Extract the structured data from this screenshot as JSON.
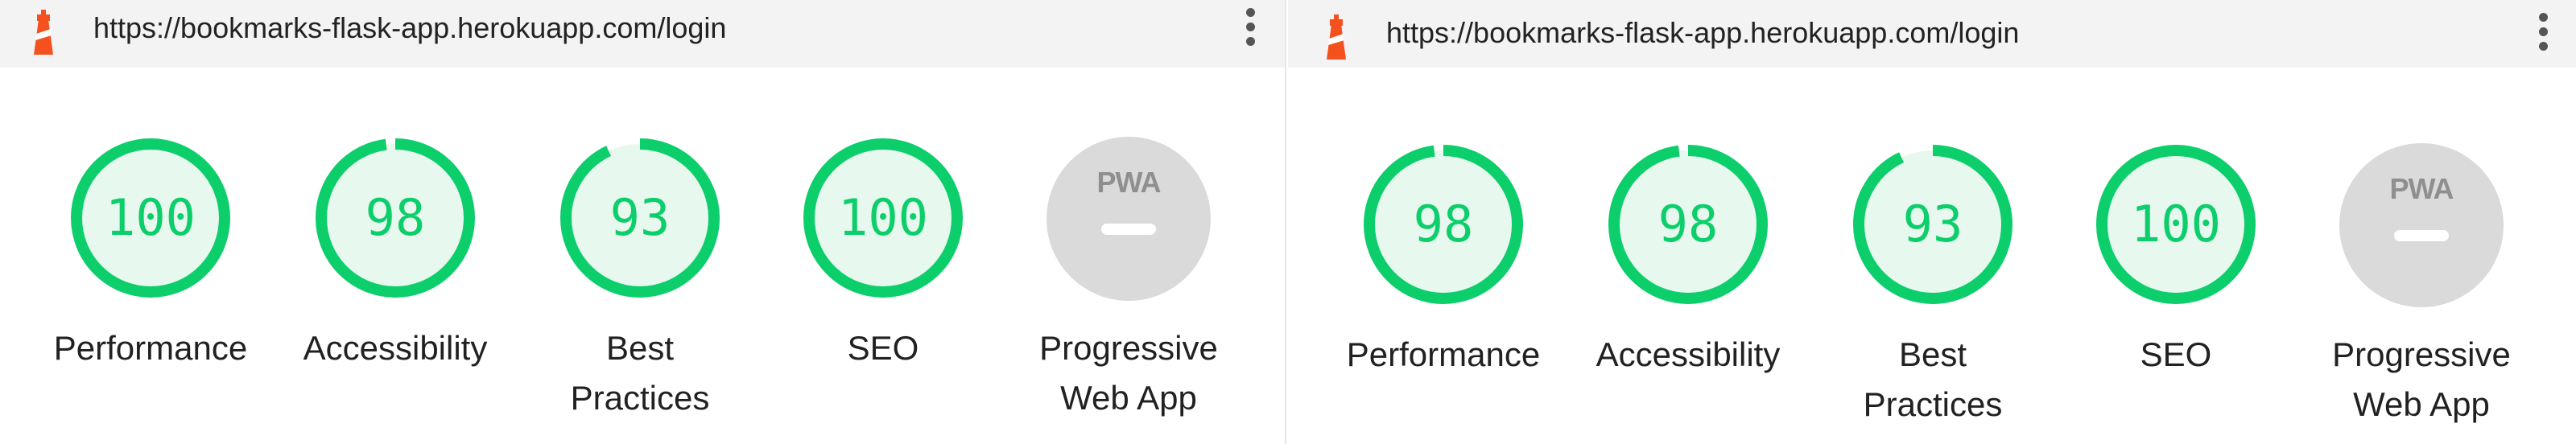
{
  "colors": {
    "pass": "#0cce6b",
    "pass_bg": "#e7f8ee",
    "na": "#dadada",
    "brand": "#f4511e"
  },
  "panels": [
    {
      "url": "https://bookmarks-flask-app.herokuapp.com/login",
      "scores": [
        {
          "label_lines": [
            "Performance"
          ],
          "value": "100"
        },
        {
          "label_lines": [
            "Accessibility"
          ],
          "value": "98"
        },
        {
          "label_lines": [
            "Best",
            "Practices"
          ],
          "value": "93"
        },
        {
          "label_lines": [
            "SEO"
          ],
          "value": "100"
        }
      ],
      "pwa": {
        "badge": "PWA",
        "label_lines": [
          "Progressive",
          "Web App"
        ]
      }
    },
    {
      "url": "https://bookmarks-flask-app.herokuapp.com/login",
      "scores": [
        {
          "label_lines": [
            "Performance"
          ],
          "value": "98"
        },
        {
          "label_lines": [
            "Accessibility"
          ],
          "value": "98"
        },
        {
          "label_lines": [
            "Best",
            "Practices"
          ],
          "value": "93"
        },
        {
          "label_lines": [
            "SEO"
          ],
          "value": "100"
        }
      ],
      "pwa": {
        "badge": "PWA",
        "label_lines": [
          "Progressive",
          "Web App"
        ]
      }
    }
  ]
}
